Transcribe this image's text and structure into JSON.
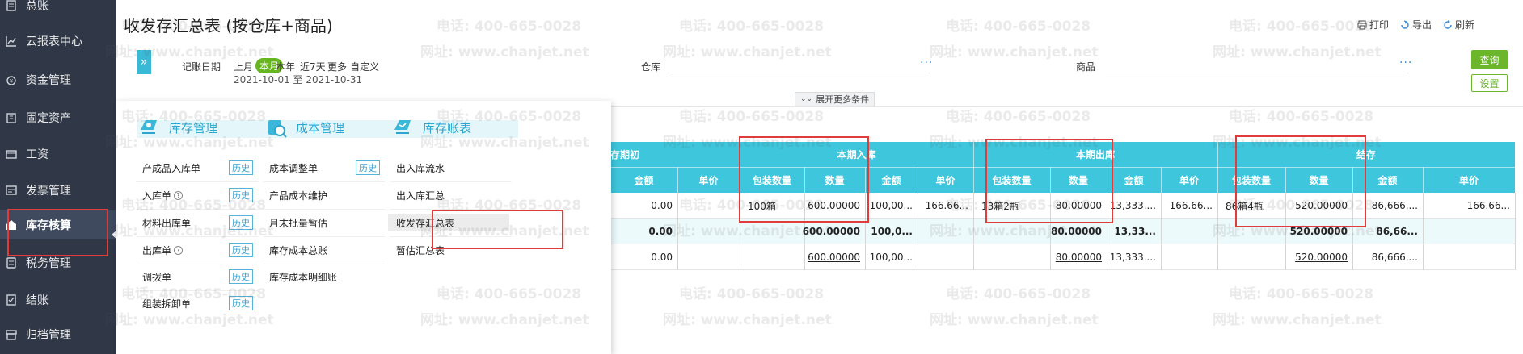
{
  "sidebar": {
    "items": [
      {
        "label": "总账",
        "icon": "ledger-icon"
      },
      {
        "label": "云报表中心",
        "icon": "chart-icon"
      },
      {
        "label": "资金管理",
        "icon": "money-icon"
      },
      {
        "label": "固定资产",
        "icon": "building-icon"
      },
      {
        "label": "工资",
        "icon": "salary-icon"
      },
      {
        "label": "发票管理",
        "icon": "invoice-icon"
      },
      {
        "label": "库存核算",
        "icon": "warehouse-icon"
      },
      {
        "label": "税务管理",
        "icon": "tax-icon"
      },
      {
        "label": "结账",
        "icon": "close-book-icon"
      },
      {
        "label": "归档管理",
        "icon": "archive-icon"
      }
    ],
    "active_index": 6
  },
  "page": {
    "title": "收发存汇总表 (按仓库+商品)"
  },
  "toolbar": {
    "print": "打印",
    "export": "导出",
    "refresh": "刷新"
  },
  "filters": {
    "date_label": "记账日期",
    "periods": [
      "上月",
      "本月",
      "本年",
      "近7天",
      "更多",
      "自定义"
    ],
    "active_period": "本月",
    "date_range": "2021-10-01 至 2021-10-31",
    "warehouse_label": "仓库",
    "product_label": "商品",
    "ellipsis": "···",
    "query_button": "查询",
    "settings_button": "设置",
    "expand_more": "展开更多条件"
  },
  "table": {
    "group_headers": {
      "opening_suffix": "存期初",
      "inbound": "本期入库",
      "outbound": "本期出库",
      "closing": "结存"
    },
    "sub_headers": {
      "opening": [
        "金额",
        "单价"
      ],
      "inbound": [
        "包装数量",
        "数量",
        "金额",
        "单价"
      ],
      "outbound": [
        "包装数量",
        "数量",
        "金额",
        "单价"
      ],
      "closing": [
        "包装数量",
        "数量",
        "金额",
        "单价"
      ]
    },
    "rows": [
      {
        "opening": [
          "0.00",
          ""
        ],
        "inbound": [
          "100箱",
          "600.00000",
          "100,00...",
          "166.66..."
        ],
        "outbound": [
          "13箱2瓶",
          "80.00000",
          "13,333....",
          "166.66..."
        ],
        "closing": [
          "86箱4瓶",
          "520.00000",
          "86,666....",
          "166.66..."
        ]
      },
      {
        "opening": [
          "0.00",
          ""
        ],
        "inbound": [
          "",
          "600.00000",
          "100,0...",
          ""
        ],
        "outbound": [
          "",
          "80.00000",
          "13,33...",
          ""
        ],
        "closing": [
          "",
          "520.00000",
          "86,66...",
          ""
        ]
      },
      {
        "opening": [
          "0.00",
          ""
        ],
        "inbound": [
          "",
          "600.00000",
          "100,00...",
          ""
        ],
        "outbound": [
          "",
          "80.00000",
          "13,333....",
          ""
        ],
        "closing": [
          "",
          "520.00000",
          "86,666....",
          ""
        ]
      }
    ]
  },
  "flyout": {
    "columns": [
      {
        "title": "库存管理",
        "icon": "inventory-icon",
        "entries": [
          {
            "label": "产成品入库单",
            "history": "历史",
            "help": false
          },
          {
            "label": "入库单",
            "history": "历史",
            "help": true
          },
          {
            "label": "材料出库单",
            "history": "历史",
            "help": false
          },
          {
            "label": "出库单",
            "history": "历史",
            "help": true
          },
          {
            "label": "调拨单",
            "history": "历史",
            "help": false
          },
          {
            "label": "组装拆卸单",
            "history": "历史",
            "help": false
          }
        ]
      },
      {
        "title": "成本管理",
        "icon": "cost-icon",
        "entries": [
          {
            "label": "成本调整单",
            "history": "历史",
            "help": false
          },
          {
            "label": "产品成本维护",
            "history": "",
            "help": false
          },
          {
            "label": "月末批量暂估",
            "history": "",
            "help": false
          },
          {
            "label": "库存成本总账",
            "history": "",
            "help": false
          },
          {
            "label": "库存成本明细账",
            "history": "",
            "help": false
          }
        ]
      },
      {
        "title": "库存账表",
        "icon": "report-icon",
        "entries": [
          {
            "label": "出入库流水",
            "highlighted": false
          },
          {
            "label": "出入库汇总",
            "highlighted": false
          },
          {
            "label": "收发存汇总表",
            "highlighted": true
          },
          {
            "label": "暂估汇总表",
            "highlighted": false
          }
        ]
      }
    ]
  },
  "watermark": {
    "phone": "电话: 400-665-0028",
    "site": "网址: www.chanjet.net"
  },
  "colors": {
    "sidebar_bg": "#303848",
    "header_cyan": "#3ec6dd",
    "accent_green": "#67b51f",
    "highlight_red": "#e03c3c",
    "menu_blue": "#2aa6cf"
  }
}
